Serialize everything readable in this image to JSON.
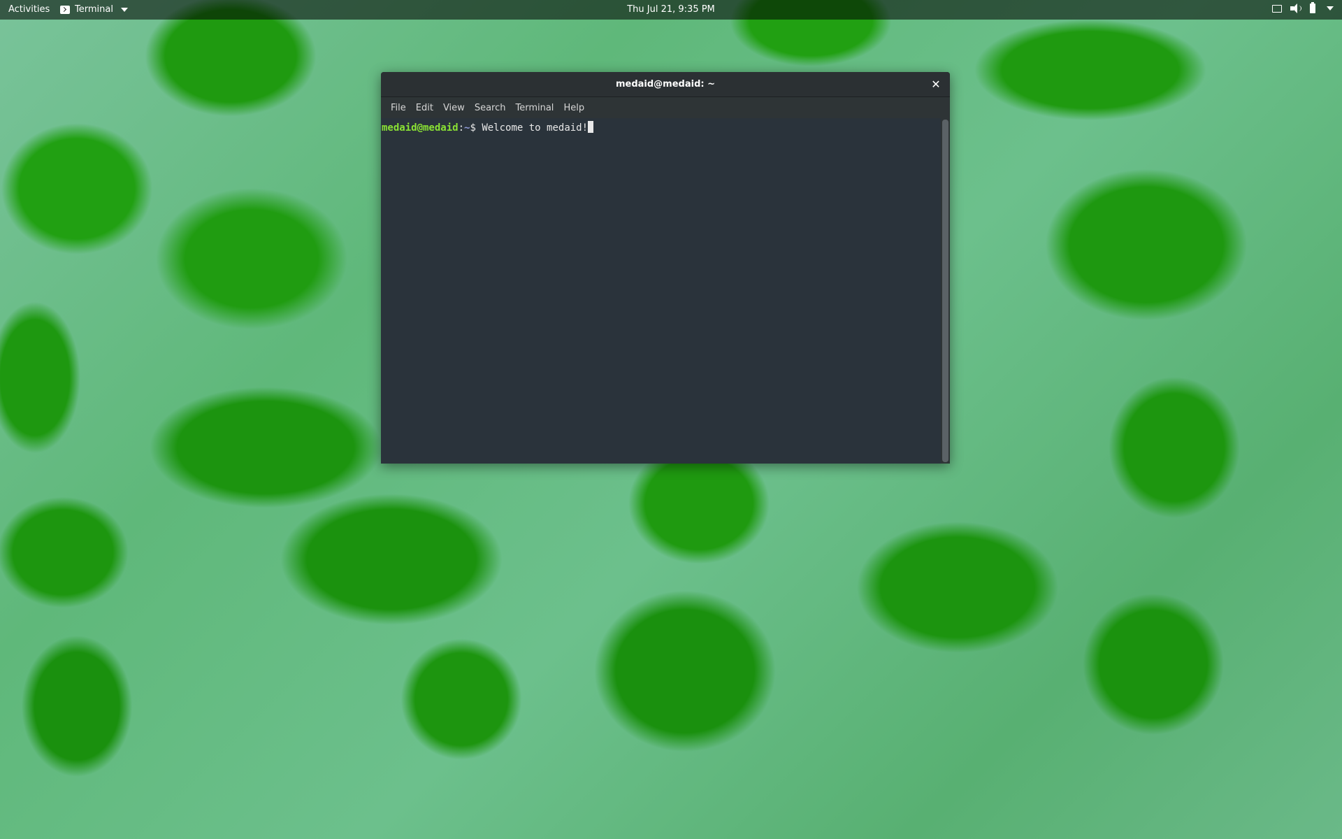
{
  "topbar": {
    "activities": "Activities",
    "app_menu_label": "Terminal",
    "clock": "Thu Jul 21,  9:35 PM",
    "icons": [
      "terminal-icon",
      "chevron-down-icon",
      "display-icon",
      "volume-icon",
      "battery-icon",
      "chevron-down-icon"
    ]
  },
  "terminal": {
    "title": "medaid@medaid: ~",
    "close_glyph": "✕",
    "menu": [
      "File",
      "Edit",
      "View",
      "Search",
      "Terminal",
      "Help"
    ],
    "prompt_user_host": "medaid@medaid",
    "prompt_separator": ":",
    "prompt_path": "~",
    "prompt_symbol": "$ ",
    "command_text": "Welcome to medaid!"
  },
  "colors": {
    "terminal_bg": "#2a333b",
    "prompt_user": "#8ae234",
    "prompt_path": "#8f9bd8",
    "topbar_bg": "#000000"
  }
}
